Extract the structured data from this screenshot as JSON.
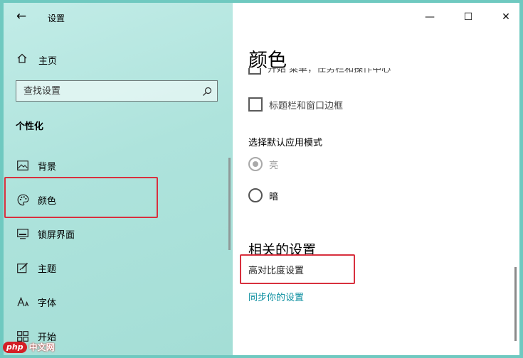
{
  "app_title": "设置",
  "sidebar": {
    "home_label": "主页",
    "search_placeholder": "查找设置",
    "section_title": "个性化",
    "items": [
      {
        "label": "背景",
        "icon": "picture-icon"
      },
      {
        "label": "颜色",
        "icon": "palette-icon"
      },
      {
        "label": "锁屏界面",
        "icon": "lock-screen-icon"
      },
      {
        "label": "主题",
        "icon": "theme-icon"
      },
      {
        "label": "字体",
        "icon": "font-icon"
      },
      {
        "label": "开始",
        "icon": "start-icon"
      }
    ]
  },
  "window_controls": {
    "minimize": "—",
    "maximize": "☐",
    "close": "✕"
  },
  "main": {
    "title": "颜色",
    "clipped_checkbox_label": "开始 菜单，任务栏和操作中心",
    "checkbox_titlebar_label": "标题栏和窗口边框",
    "mode_label": "选择默认应用模式",
    "mode_options": [
      {
        "label": "亮",
        "selected": true,
        "disabled": true
      },
      {
        "label": "暗",
        "selected": false,
        "disabled": false
      }
    ],
    "related_title": "相关的设置",
    "links": [
      "高对比度设置",
      "同步你的设置"
    ]
  },
  "watermark": {
    "badge": "php",
    "text": "中文网"
  },
  "colors": {
    "accent": "#0d8fa0",
    "highlight_box": "#d8303e",
    "sidebar_bg": "#aee3dc",
    "desktop_bg": "#6fc9c0"
  }
}
